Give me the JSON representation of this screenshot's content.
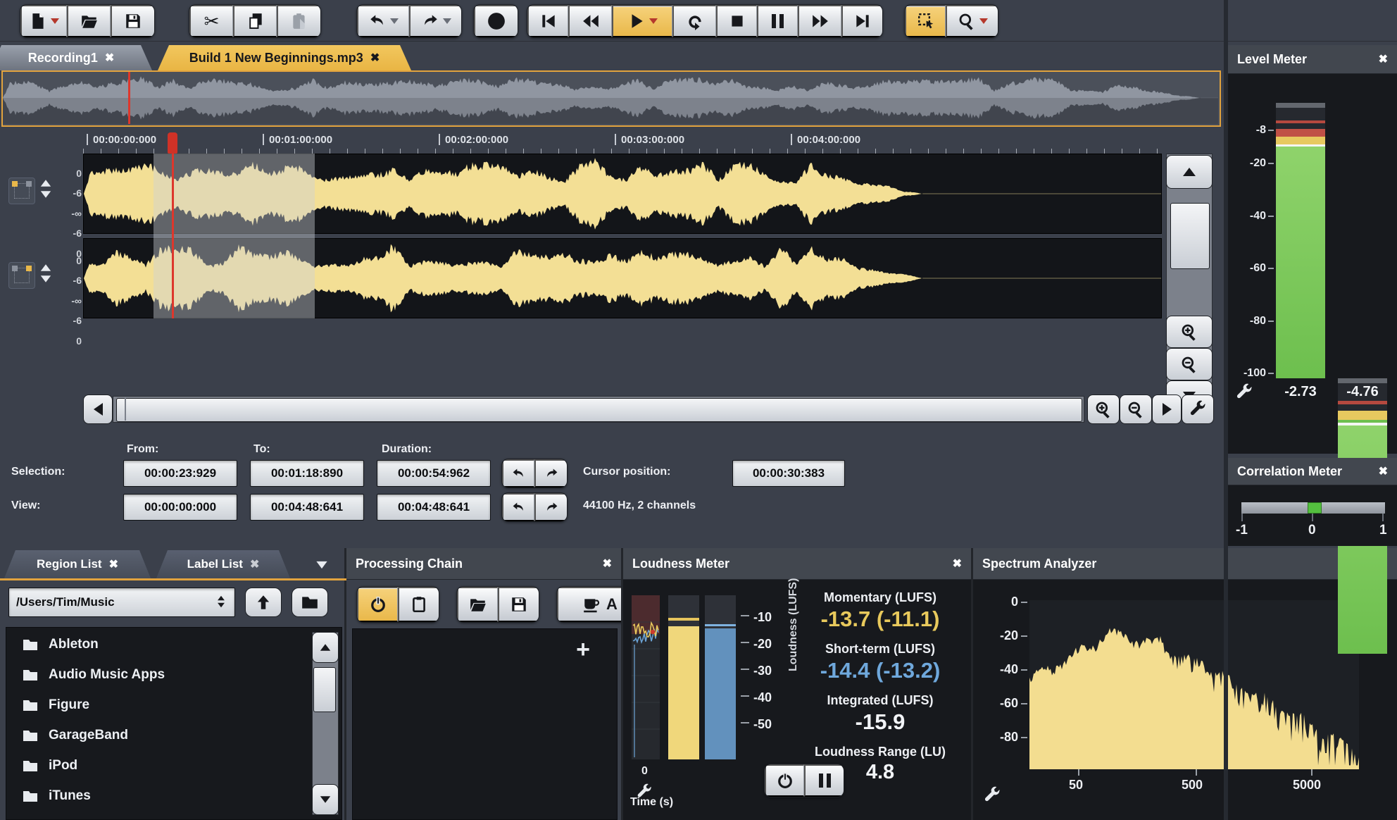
{
  "icons": {
    "close": "✖",
    "scissors": "✂",
    "plus": "+"
  },
  "tabs": {
    "recording": "Recording1",
    "file": "Build 1 New Beginnings.mp3"
  },
  "ruler_labels": [
    "00:00:00:000",
    "00:01:00:000",
    "00:02:00:000",
    "00:03:00:000",
    "00:04:00:000"
  ],
  "db_scale": [
    "0",
    "-6",
    "-∞",
    "-6",
    "0"
  ],
  "info": {
    "from_header": "From:",
    "to_header": "To:",
    "duration_header": "Duration:",
    "selection_label": "Selection:",
    "selection_from": "00:00:23:929",
    "selection_to": "00:01:18:890",
    "selection_duration": "00:00:54:962",
    "cursor_label": "Cursor position:",
    "cursor_value": "00:00:30:383",
    "view_label": "View:",
    "view_from": "00:00:00:000",
    "view_to": "00:04:48:641",
    "view_duration": "00:04:48:641",
    "format_info": "44100 Hz, 2 channels"
  },
  "level_meter": {
    "title": "Level Meter",
    "scale": [
      "-8",
      "-20",
      "-40",
      "-60",
      "-80",
      "-100"
    ],
    "left_value": "-2.73",
    "right_value": "-4.76"
  },
  "correlation_meter": {
    "title": "Correlation Meter",
    "ticks": [
      "-1",
      "0",
      "1"
    ]
  },
  "region_panel": {
    "region_tab": "Region List",
    "label_tab": "Label List",
    "path": "/Users/Tim/Music",
    "folders": [
      "Ableton",
      "Audio Music Apps",
      "Figure",
      "GarageBand",
      "iPod",
      "iTunes"
    ]
  },
  "processing_panel": {
    "title": "Processing Chain",
    "apply_text": "A"
  },
  "loudness_panel": {
    "title": "Loudness Meter",
    "y_axis": "Loudness (LUFS)",
    "x_axis": "Time (s)",
    "x_tick": "0",
    "scale": [
      "-10",
      "-20",
      "-30",
      "-40",
      "-50"
    ],
    "momentary_label": "Momentary (LUFS)",
    "momentary_value": "-13.7 (-11.1)",
    "short_label": "Short-term (LUFS)",
    "short_value": "-14.4 (-13.2)",
    "integrated_label": "Integrated (LUFS)",
    "integrated_value": "-15.9",
    "range_label": "Loudness Range (LU)",
    "range_value": "4.8"
  },
  "spectrum_panel": {
    "title": "Spectrum Analyzer",
    "y_ticks": [
      "0",
      "-20",
      "-40",
      "-60",
      "-80"
    ],
    "x_ticks": [
      "50",
      "500",
      "5000"
    ]
  },
  "colors": {
    "accent": "#e9b84a",
    "waveform": "#f3df95",
    "meter_green": "#74c454",
    "cursor_red": "#dd372c",
    "short_term_blue": "#6291bd"
  }
}
